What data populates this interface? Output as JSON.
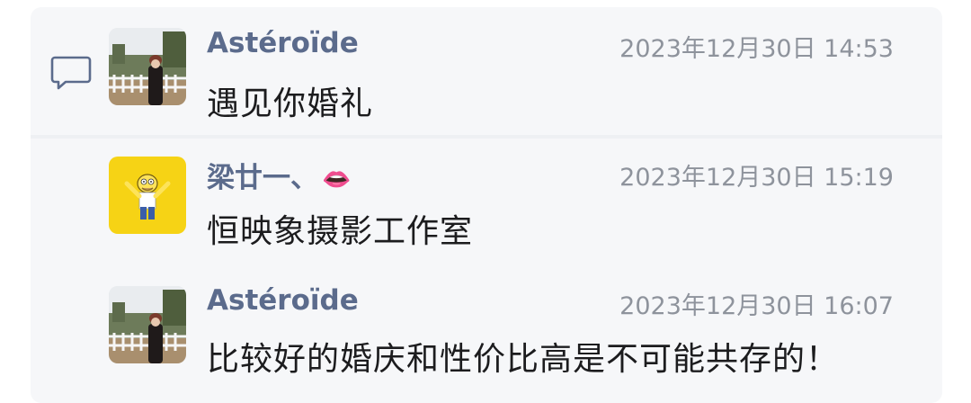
{
  "messages": [
    {
      "author": "Astéroïde",
      "time": "2023年12月30日 14:53",
      "text": "遇见你婚礼",
      "avatar": "photo-avatar"
    },
    {
      "author": "梁廿一、",
      "author_emoji": "👄",
      "time": "2023年12月30日 15:19",
      "text": "恒映象摄影工作室",
      "avatar": "cartoon-avatar"
    },
    {
      "author": "Astéroïde",
      "time": "2023年12月30日 16:07",
      "text": "比较好的婚庆和性价比高是不可能共存的！",
      "avatar": "photo-avatar"
    }
  ],
  "icons": {
    "comment": "comment-icon"
  },
  "colors": {
    "name": "#5b6b8c",
    "time": "#8e939c",
    "text": "#1c1c1e",
    "panel": "#f6f7f9"
  }
}
